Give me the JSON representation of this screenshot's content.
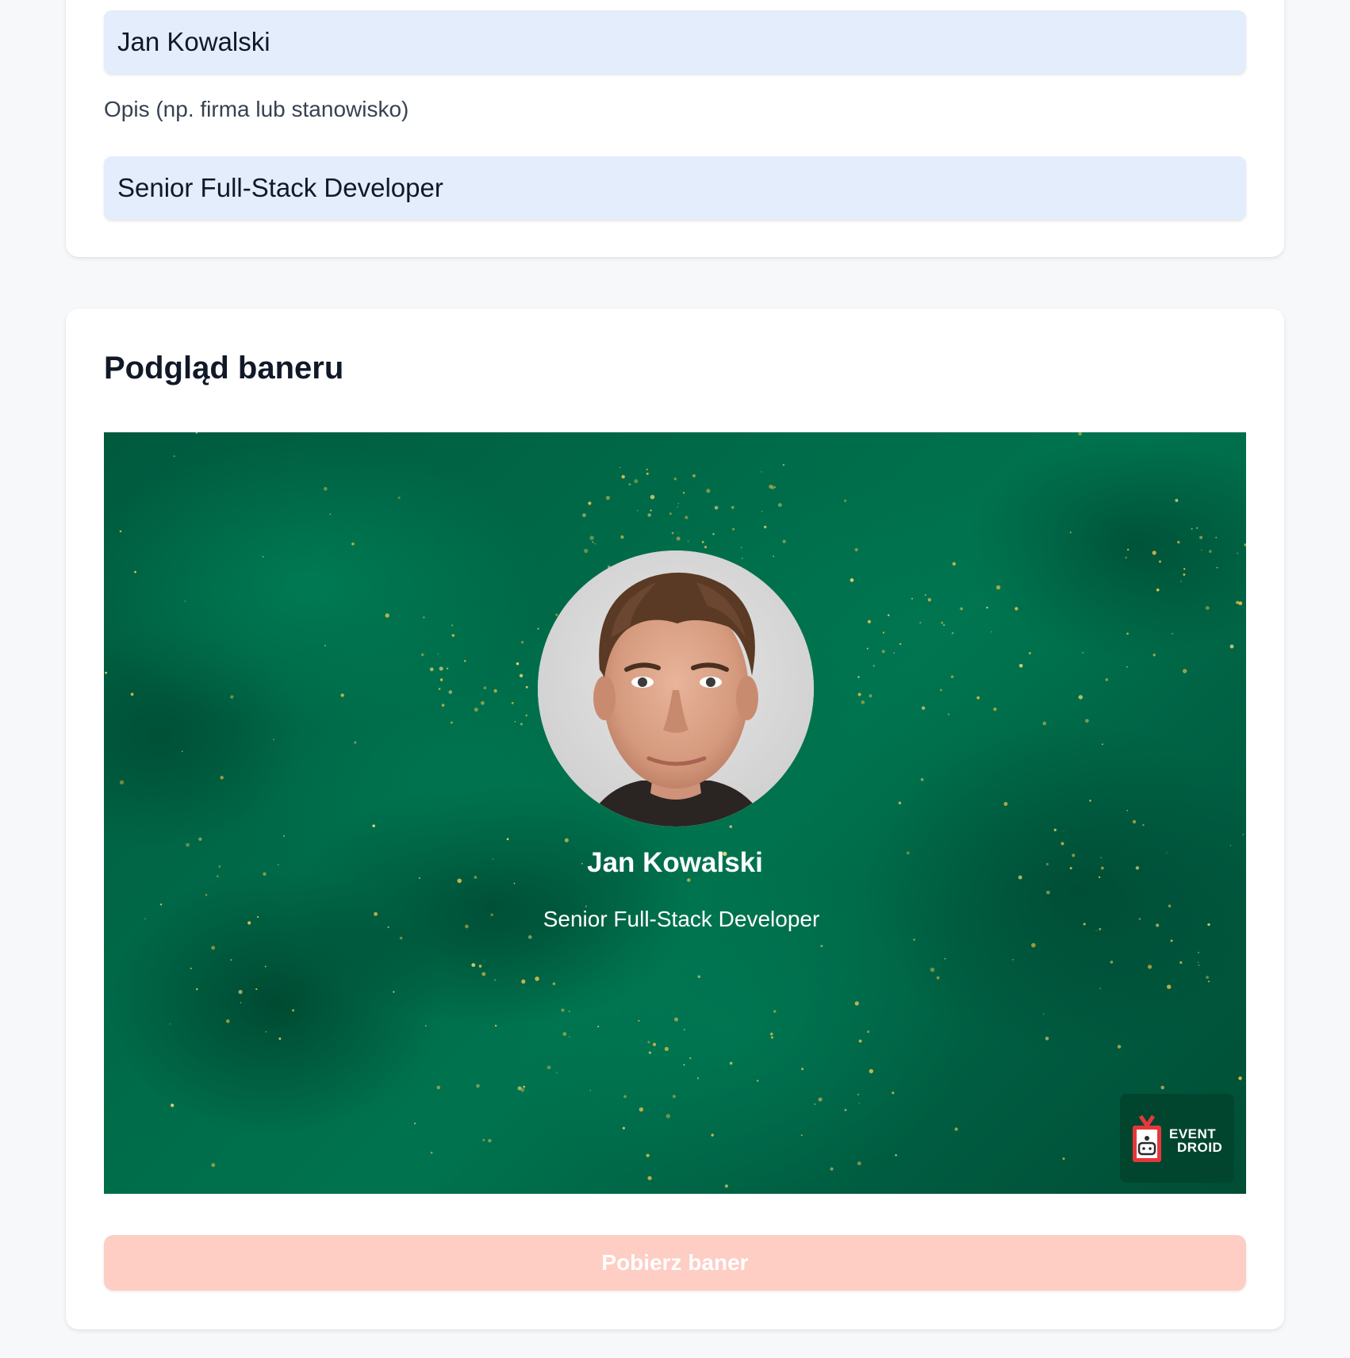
{
  "form": {
    "name_value": "Jan Kowalski",
    "description_label": "Opis (np. firma lub stanowisko)",
    "description_value": "Senior Full-Stack Developer"
  },
  "preview": {
    "title": "Podgląd baneru",
    "banner": {
      "name": "Jan Kowalski",
      "role": "Senior Full-Stack Developer",
      "logo_line1": "EVENT",
      "logo_line2": "DROID"
    },
    "download_button_label": "Pobierz baner"
  },
  "colors": {
    "page_background": "#f7f8fa",
    "input_background": "#e3edfc",
    "banner_green": "#006b49",
    "logo_red": "#e5383b",
    "button_disabled": "#fecdc3"
  }
}
